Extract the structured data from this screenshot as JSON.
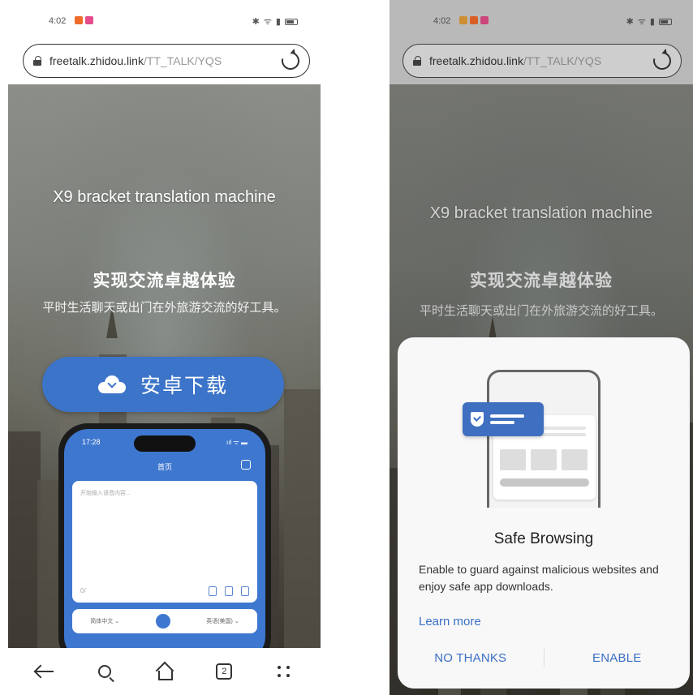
{
  "left": {
    "status": {
      "time": "4:02",
      "icons": "✱ ᯤ ▮"
    },
    "url": {
      "host": "freetalk.zhidou.link",
      "path": "/TT_TALK/YQS"
    },
    "hero": {
      "title": "X9 bracket translation machine",
      "subtitle": "实现交流卓越体验",
      "description": "平时生活聊天或出门在外旅游交流的好工具。"
    },
    "download_label": "安卓下载",
    "mock": {
      "time": "17:28",
      "status": "ııl ᯤ ▬",
      "title": "首页",
      "placeholder": "开始输入语音内容...",
      "count": "0/",
      "lang_from": "简体中文 ⌄",
      "lang_to": "英语(美国) ⌄"
    },
    "nav": {
      "tabs_count": "2"
    }
  },
  "right": {
    "status": {
      "time": "4:02",
      "icons": "✱ ᯤ ▮"
    },
    "url": {
      "host": "freetalk.zhidou.link",
      "path": "/TT_TALK/YQS"
    },
    "hero": {
      "title": "X9 bracket translation machine",
      "subtitle": "实现交流卓越体验",
      "description": "平时生活聊天或出门在外旅游交流的好工具。"
    },
    "dialog": {
      "title": "Safe Browsing",
      "description": "Enable to guard against malicious websites and enjoy safe app downloads.",
      "learn_more": "Learn more",
      "no_thanks": "NO THANKS",
      "enable": "ENABLE"
    }
  },
  "colors": {
    "accent": "#3c74c9",
    "link": "#3a6fc4",
    "notif_orange": "#f06a2a",
    "notif_pink": "#e44d8a"
  }
}
